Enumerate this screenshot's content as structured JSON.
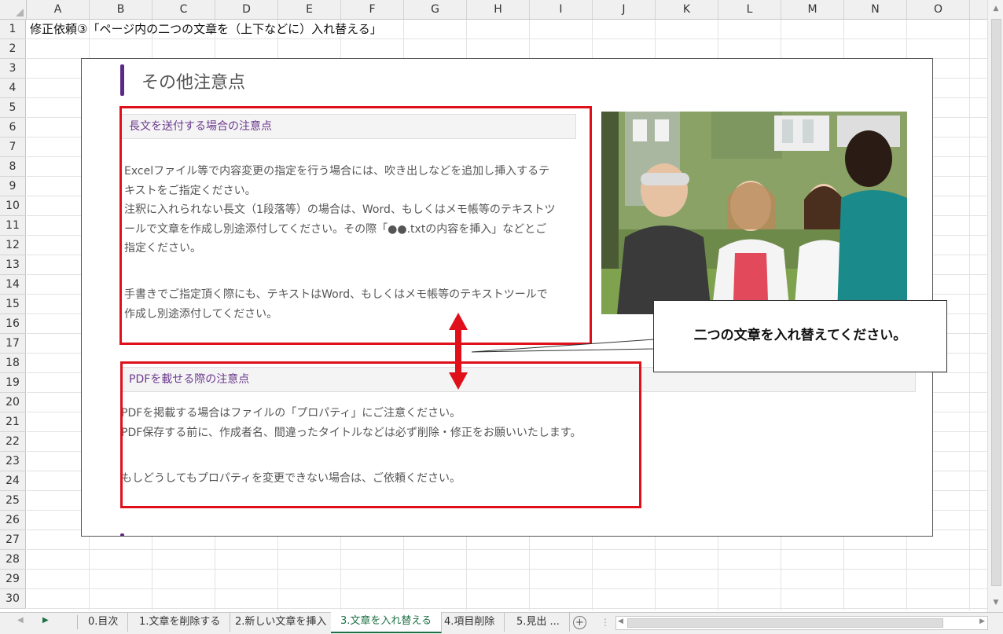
{
  "columns": [
    "A",
    "B",
    "C",
    "D",
    "E",
    "F",
    "G",
    "H",
    "I",
    "J",
    "K",
    "L",
    "M",
    "N",
    "O"
  ],
  "rows": [
    "1",
    "2",
    "3",
    "4",
    "5",
    "6",
    "7",
    "8",
    "9",
    "10",
    "11",
    "12",
    "13",
    "14",
    "15",
    "16",
    "17",
    "18",
    "19",
    "20",
    "21",
    "22",
    "23",
    "24",
    "25",
    "26",
    "27",
    "28",
    "29",
    "30"
  ],
  "cell_a1": "修正依頼③「ページ内の二つの文章を（上下などに）入れ替える」",
  "page": {
    "title": "その他注意点",
    "section1": {
      "heading": "長文を送付する場合の注意点",
      "lines": [
        "Excelファイル等で内容変更の指定を行う場合には、吹き出しなどを追加し挿入するテ",
        "キストをご指定ください。",
        "注釈に入れられない長文（1段落等）の場合は、Word、もしくはメモ帳等のテキストツ",
        "ールで文章を作成し別途添付してください。その際「●●.txtの内容を挿入」などとご",
        "指定ください。"
      ],
      "lines2": [
        "手書きでご指定頂く際にも、テキストはWord、もしくはメモ帳等のテキストツールで",
        "作成し別途添付してください。"
      ]
    },
    "section2": {
      "heading": "PDFを載せる際の注意点",
      "lines": [
        "PDFを掲載する場合はファイルの「プロパティ」にご注意ください。",
        "PDF保存する前に、作成者名、間違ったタイトルなどは必ず削除・修正をお願いいたします。"
      ],
      "lines2": [
        "もしどうしてもプロパティを変更できない場合は、ご依頼ください。"
      ]
    }
  },
  "callout_text": "二つの文章を入れ替えてください。",
  "sheet_tabs": [
    "0.目次",
    "1.文章を削除する",
    "2.新しい文章を挿入",
    "3.文章を入れ替える",
    "4.項目削除",
    "5.見出 ..."
  ],
  "active_tab": "3.文章を入れ替える",
  "colors": {
    "accent_purple": "#5b2a86",
    "highlight_red": "#e0101a",
    "excel_green": "#1e7145"
  }
}
